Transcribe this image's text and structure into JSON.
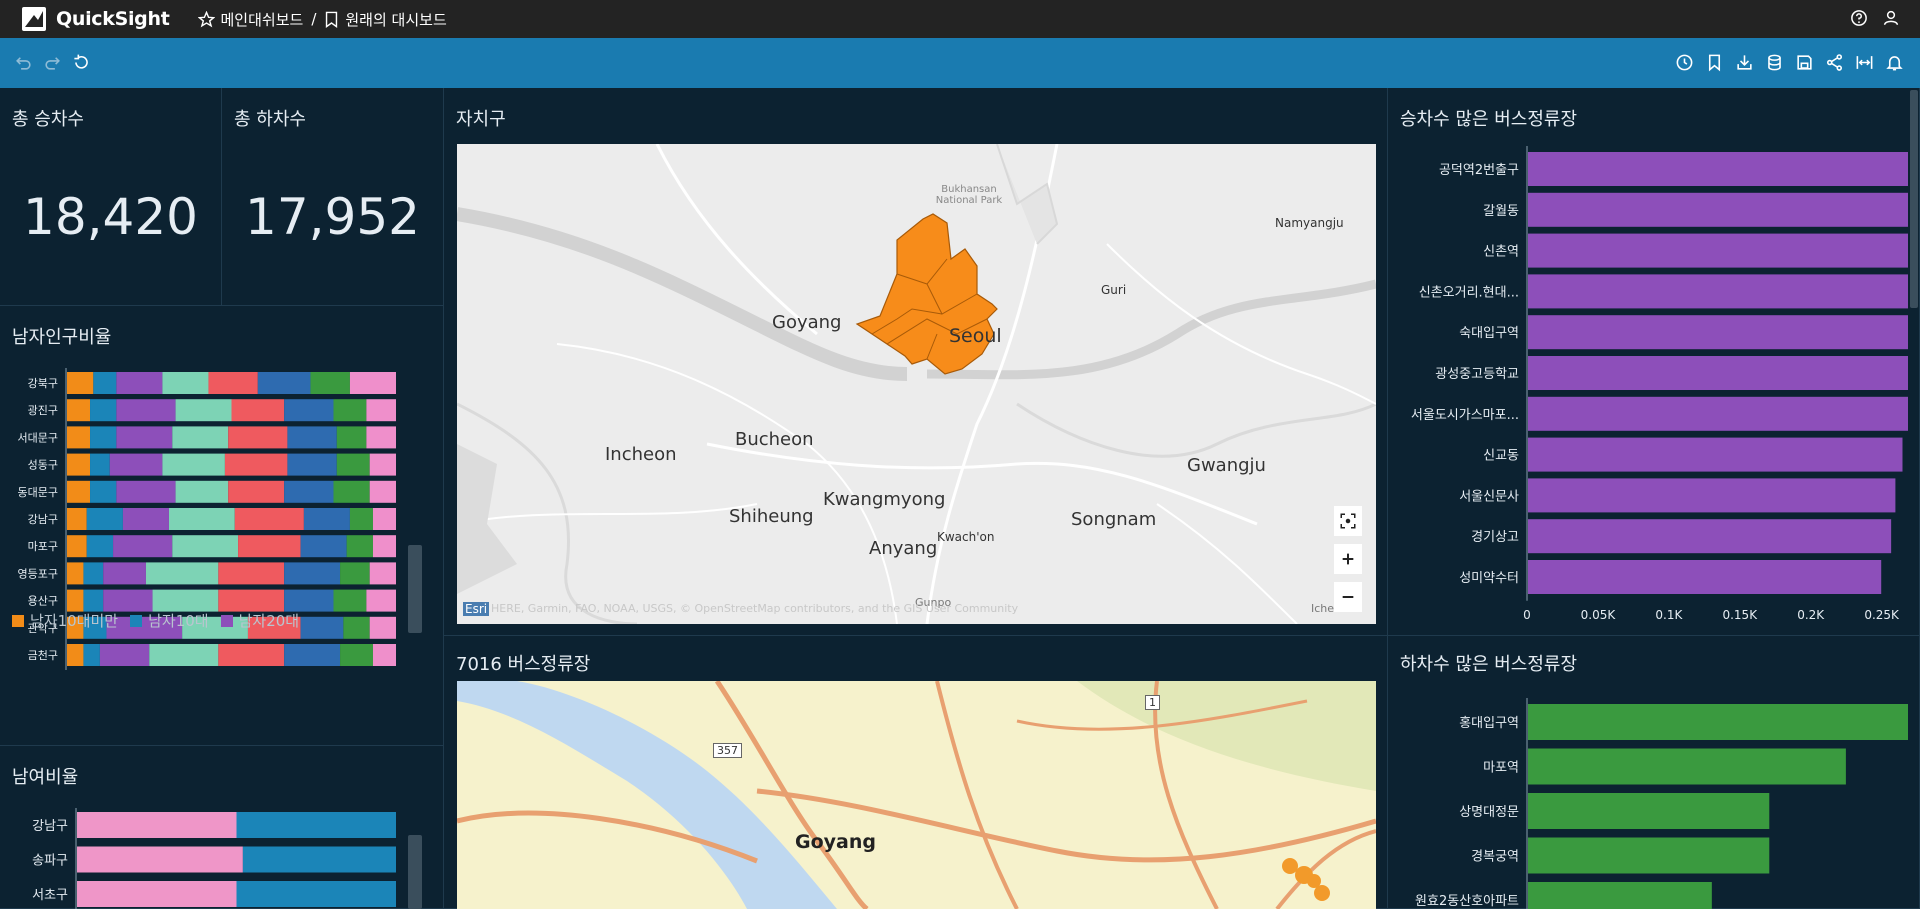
{
  "app": {
    "name": "QuickSight"
  },
  "breadcrumb": {
    "parent": "메인대쉬보드",
    "separator": "/",
    "current": "원래의 대시보드"
  },
  "kpi": {
    "boardings": {
      "title": "총 승차수",
      "value": "18,420"
    },
    "alightings": {
      "title": "총 하차수",
      "value": "17,952"
    }
  },
  "male_ratio": {
    "title": "남자인구비율",
    "districts": [
      "강북구",
      "광진구",
      "서대문구",
      "성동구",
      "동대문구",
      "강남구",
      "마포구",
      "영등포구",
      "용산구",
      "관악구",
      "금천구"
    ],
    "colors": [
      "#f28c18",
      "#1b85b8",
      "#8d4fba",
      "#7dd3b5",
      "#ef5a5f",
      "#2e6bb0",
      "#3a9a3f",
      "#ef8fcb"
    ],
    "segments": [
      [
        8,
        7,
        14,
        14,
        15,
        16,
        12,
        14
      ],
      [
        7,
        8,
        18,
        17,
        16,
        15,
        10,
        9
      ],
      [
        7,
        8,
        17,
        17,
        18,
        15,
        9,
        9
      ],
      [
        7,
        6,
        16,
        19,
        19,
        15,
        10,
        8
      ],
      [
        7,
        8,
        18,
        16,
        17,
        15,
        11,
        8
      ],
      [
        6,
        11,
        14,
        20,
        21,
        14,
        7,
        7
      ],
      [
        6,
        8,
        18,
        20,
        19,
        14,
        8,
        7
      ],
      [
        5,
        6,
        13,
        22,
        20,
        17,
        9,
        8
      ],
      [
        5,
        6,
        15,
        20,
        20,
        15,
        10,
        9
      ],
      [
        5,
        7,
        23,
        20,
        16,
        13,
        8,
        8
      ],
      [
        5,
        5,
        15,
        21,
        20,
        17,
        10,
        7
      ]
    ],
    "legend": [
      {
        "label": "남자10대미만",
        "color": "#f28c18"
      },
      {
        "label": "남자10대",
        "color": "#1b85b8"
      },
      {
        "label": "남자20대",
        "color": "#8d4fba"
      }
    ]
  },
  "gender_ratio": {
    "title": "남여비율",
    "districts": [
      "강남구",
      "송파구",
      "서초구"
    ],
    "female_share": [
      0.5,
      0.52,
      0.5
    ],
    "colors": {
      "female": "#ef96c8",
      "male": "#1b85b8"
    }
  },
  "district_map": {
    "title": "자치구",
    "labels": {
      "goyang": "Goyang",
      "seoul": "Seoul",
      "incheon": "Incheon",
      "bucheon": "Bucheon",
      "gwangju": "Gwangju",
      "shiheung": "Shiheung",
      "kwangmyong": "Kwangmyong",
      "anyang": "Anyang",
      "songnam": "Songnam",
      "guri": "Guri",
      "namyangju": "Namyangju",
      "park": "Bukhansan National Park",
      "kwachon": "Kwach'on",
      "gunpo": "Gunpo",
      "iche": "Iche"
    },
    "attribution": {
      "logo": "Esri",
      "text": "HERE, Garmin, FAO, NOAA, USGS, © OpenStreetMap contributors, and the GIS User Community"
    },
    "region_color": "#f78c1a"
  },
  "stop_map": {
    "title": "7016 버스정류장",
    "labels": {
      "goyang": "Goyang",
      "route_357": "357",
      "route_1": "1"
    }
  },
  "top_boarding": {
    "title": "승차수 많은 버스정류장",
    "chart_data": {
      "type": "bar",
      "orientation": "horizontal",
      "categories": [
        "공덕역2번출구",
        "갈월동",
        "신촌역",
        "신촌오거리.현대...",
        "숙대입구역",
        "광성중고등학교",
        "서울도시가스마포...",
        "신교동",
        "서울신문사",
        "경기상고",
        "성미약수터"
      ],
      "values": [
        270,
        270,
        270,
        268,
        270,
        269,
        270,
        264,
        259,
        256,
        249
      ],
      "xlim": [
        0,
        270
      ],
      "ticks": [
        0,
        50,
        100,
        150,
        200,
        250
      ],
      "tick_labels": [
        "0",
        "0.05K",
        "0.1K",
        "0.15K",
        "0.2K",
        "0.25K"
      ],
      "color": "#8d4fba"
    }
  },
  "top_alighting": {
    "title": "하차수 많은 버스정류장",
    "chart_data": {
      "type": "bar",
      "orientation": "horizontal",
      "categories": [
        "홍대입구역",
        "마포역",
        "상명대정문",
        "경복궁역",
        "원효2동산호아파트"
      ],
      "values": [
        100,
        83,
        63,
        63,
        48
      ],
      "xlim": [
        0,
        100
      ],
      "color": "#3a9a3f"
    }
  }
}
